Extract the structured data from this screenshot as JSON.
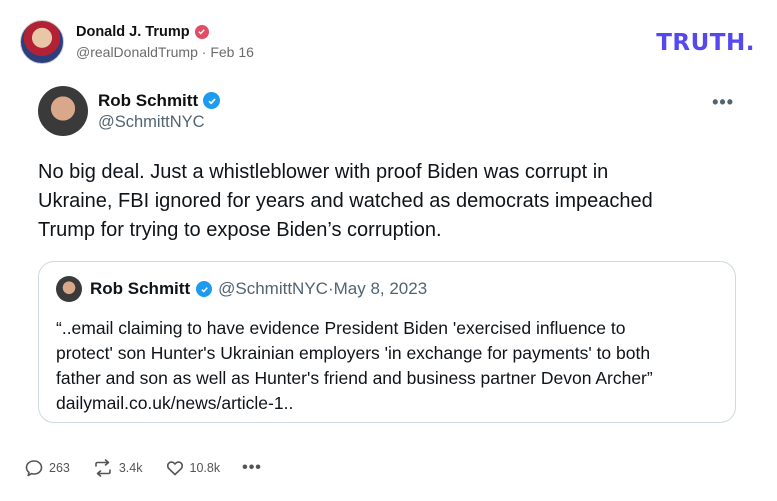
{
  "truth_post": {
    "author_name": "Donald J. Trump",
    "handle": "@realDonaldTrump",
    "separator": " · ",
    "date": "Feb 16",
    "logo": "TRUTH."
  },
  "tweet": {
    "author_name": "Rob Schmitt",
    "handle": "@SchmittNYC",
    "body_lines": [
      "No big deal.  Just a whistleblower with proof Biden was corrupt in",
      "Ukraine, FBI ignored for years and watched as democrats impeached",
      "Trump for trying to expose Biden’s corruption."
    ],
    "quote": {
      "author_name": "Rob Schmitt",
      "handle": "@SchmittNYC",
      "separator": " · ",
      "date": "May 8, 2023",
      "body_lines": [
        "“..email claiming to have evidence President Biden 'exercised influence to",
        "protect' son Hunter's Ukrainian employers 'in exchange for payments' to both",
        "father and son as well as Hunter's friend and business partner Devon Archer”",
        "dailymail.co.uk/news/article-1.."
      ]
    }
  },
  "actions": {
    "replies": "263",
    "retruths": "3.4k",
    "likes": "10.8k",
    "more": "•••"
  },
  "colors": {
    "truth_brand": "#5448ee",
    "verified_blue": "#1d9bf0",
    "badge_pink": "#e04d64"
  }
}
